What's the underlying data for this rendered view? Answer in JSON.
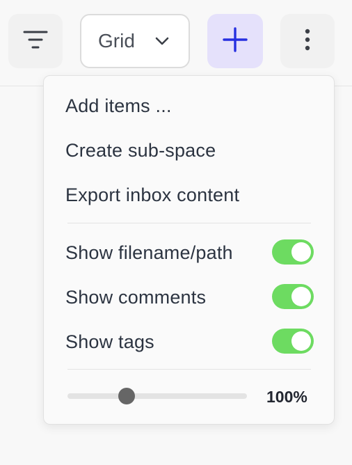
{
  "toolbar": {
    "filter_icon": "filter-lines-icon",
    "view_select": {
      "value": "Grid",
      "icon": "chevron-down-icon"
    },
    "add_icon": "plus-icon",
    "more_icon": "vertical-dots-icon",
    "colors": {
      "accent_bg": "#e5e1fb",
      "accent": "#2630e0"
    }
  },
  "menu": {
    "actions": [
      {
        "label": "Add items ..."
      },
      {
        "label": "Create sub-space"
      },
      {
        "label": "Export inbox content"
      }
    ],
    "toggles": [
      {
        "label": "Show filename/path",
        "on": true
      },
      {
        "label": "Show comments",
        "on": true
      },
      {
        "label": "Show tags",
        "on": true
      }
    ],
    "zoom": {
      "value_label": "100%",
      "level": 0.33
    },
    "colors": {
      "toggle_on": "#6ddb61",
      "slider_thumb": "#666666"
    }
  }
}
